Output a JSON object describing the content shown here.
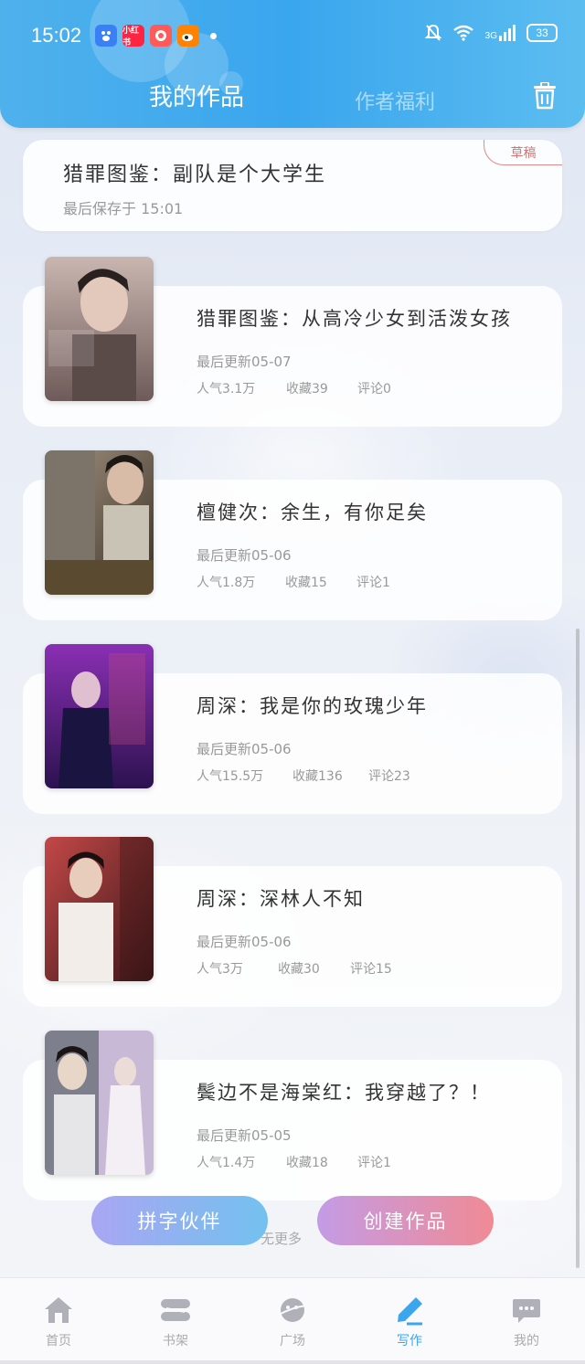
{
  "status_bar": {
    "time": "15:02",
    "apps": [
      {
        "name": "baidu-icon",
        "label": "",
        "color": "#3b7ff6"
      },
      {
        "name": "xiaohongshu-icon",
        "label": "小红书",
        "color": "#ff2442"
      },
      {
        "name": "app-icon",
        "label": "",
        "color": "#ff5a5a"
      },
      {
        "name": "weibo-icon",
        "label": "",
        "color": "#ff8200"
      }
    ],
    "network": "3G",
    "battery": "33"
  },
  "header": {
    "tab_active": "我的作品",
    "tab_inactive": "作者福利"
  },
  "draft": {
    "title": "猎罪图鉴：副队是个大学生",
    "saved": "最后保存于 15:01",
    "badge": "草稿"
  },
  "works": [
    {
      "title": "猎罪图鉴：从高冷少女到活泼女孩",
      "updated": "最后更新05-07",
      "popularity": "人气3.1万",
      "favorites": "收藏39",
      "comments": "评论0",
      "cover_colors": [
        "#c9b6b0",
        "#6e5a58"
      ]
    },
    {
      "title": "檀健次：余生，有你足矣",
      "updated": "最后更新05-06",
      "popularity": "人气1.8万",
      "favorites": "收藏15",
      "comments": "评论1",
      "cover_colors": [
        "#8e7a66",
        "#3a3026"
      ]
    },
    {
      "title": "周深：我是你的玫瑰少年",
      "updated": "最后更新05-06",
      "popularity": "人气15.5万",
      "favorites": "收藏136",
      "comments": "评论23",
      "cover_colors": [
        "#8a2fb4",
        "#2c1250"
      ]
    },
    {
      "title": "周深：深林人不知",
      "updated": "最后更新05-06",
      "popularity": "人气3万",
      "favorites": "收藏30",
      "comments": "评论15",
      "cover_colors": [
        "#c34848",
        "#3a1618"
      ]
    },
    {
      "title": "鬓边不是海棠红：我穿越了？！",
      "updated": "最后更新05-05",
      "popularity": "人气1.4万",
      "favorites": "收藏18",
      "comments": "评论1",
      "cover_colors": [
        "#7d7f8c",
        "#c8b9d6"
      ]
    }
  ],
  "actions": {
    "partner": "拼字伙伴",
    "create": "创建作品",
    "no_more": "无更多"
  },
  "nav": [
    {
      "label": "首页",
      "icon": "home-icon"
    },
    {
      "label": "书架",
      "icon": "bookshelf-icon"
    },
    {
      "label": "广场",
      "icon": "planet-icon"
    },
    {
      "label": "写作",
      "icon": "pen-icon"
    },
    {
      "label": "我的",
      "icon": "chat-bubble-icon"
    }
  ]
}
